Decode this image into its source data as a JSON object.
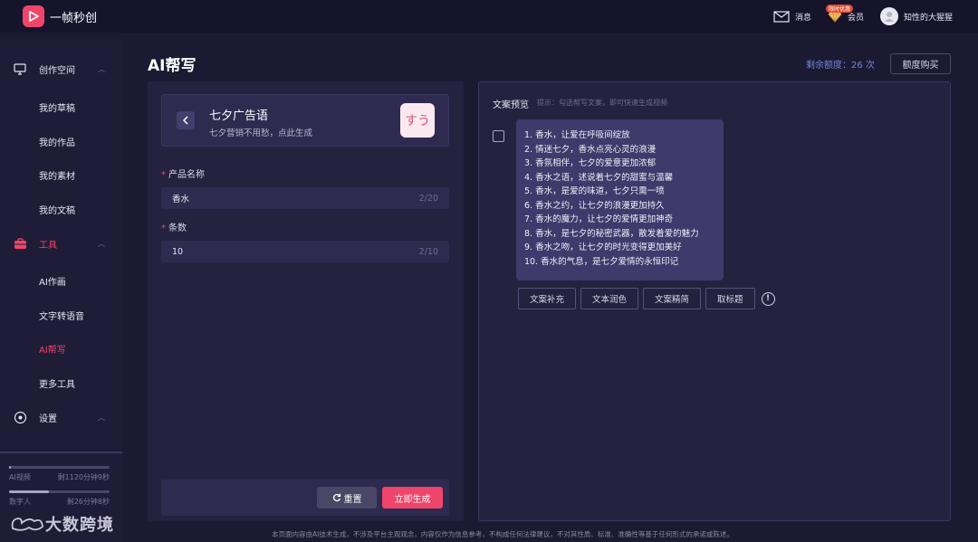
{
  "app": {
    "name": "一帧秒创"
  },
  "topbar": {
    "messages_label": "消息",
    "vip_badge": "限时优惠",
    "vip_label": "会员",
    "user_name": "知性的大猩猩"
  },
  "sidebar": {
    "groups": [
      {
        "label": "创作空间",
        "icon": "monitor-icon",
        "items": [
          "我的草稿",
          "我的作品",
          "我的素材",
          "我的文稿"
        ]
      },
      {
        "label": "工具",
        "icon": "toolbox-icon",
        "items": [
          "AI作画",
          "文字转语音",
          "AI帮写",
          "更多工具"
        ]
      },
      {
        "label": "设置",
        "icon": "settings-icon",
        "items": []
      }
    ],
    "active_item": "AI帮写",
    "usage": [
      {
        "label": "AI视频",
        "value": "剩1120分钟9秒",
        "fill": 0.02
      },
      {
        "label": "数字人",
        "value": "剩26分钟8秒",
        "fill": 0.4
      }
    ],
    "watermark": "大数跨境"
  },
  "main": {
    "title": "AI帮写",
    "quota_text": "剩余额度：26 次",
    "buy_label": "额度购买"
  },
  "form": {
    "template_title": "七夕广告语",
    "template_subtitle": "七夕营销不用愁，点此生成",
    "template_thumb_glyph": "すう",
    "fields": [
      {
        "label": "产品名称",
        "value": "香水",
        "count": "2/20"
      },
      {
        "label": "条数",
        "value": "10",
        "count": "2/10"
      }
    ],
    "reset_label": "重置",
    "generate_label": "立即生成"
  },
  "preview": {
    "title": "文案预览",
    "hint": "提示：勾选帮写文案，即可快速生成视频",
    "lines": [
      "1. 香水，让爱在呼吸间绽放",
      "2. 情迷七夕，香水点亮心灵的浪漫",
      "3. 香氛相伴，七夕的爱意更加浓郁",
      "4. 香水之语，述说着七夕的甜蜜与温馨",
      "5. 香水，是爱的味道，七夕只需一喷",
      "6. 香水之约，让七夕的浪漫更加持久",
      "7. 香水的魔力，让七夕的爱情更加神奇",
      "8. 香水，是七夕的秘密武器，散发着爱的魅力",
      "9. 香水之吻，让七夕的时光变得更加美好",
      "10. 香水的气息，是七夕爱情的永恒印记"
    ],
    "buttons": [
      "文案补充",
      "文本润色",
      "文案精简",
      "取标题"
    ]
  },
  "footer": {
    "note": "本页面内容由AI技术生成，不涉及平台主观观念，内容仅作为信息参考，不构成任何法律建议，不对其性质、标准、准确性等基于任何形式的承诺或陈述。"
  }
}
